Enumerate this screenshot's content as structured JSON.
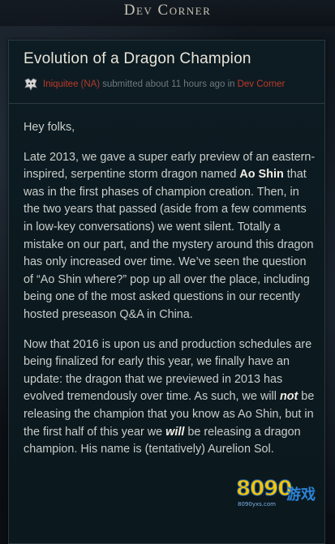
{
  "section": {
    "title": "Dev Corner"
  },
  "post": {
    "title": "Evolution of a Dragon Champion",
    "author": "Iniquitee",
    "region": "(NA)",
    "submitted_text": "submitted about 11 hours ago in",
    "board_link": "Dev Corner"
  },
  "content": {
    "greeting": "Hey folks,",
    "p2_a": "Late 2013, we gave a super early preview of an eastern-inspired, serpentine storm dragon named ",
    "p2_bold": "Ao Shin",
    "p2_b": " that was in the first phases of champion creation. Then, in the two years that passed (aside from a few comments in low-key conversations) we went silent. Totally a mistake on our part, and the mystery around this dragon has only increased over time. We’ve seen the question of “Ao Shin where?” pop up all over the place, including being one of the most asked questions in our recently hosted preseason Q&A in China.",
    "p3_a": "Now that 2016 is upon us and production schedules are being finalized for early this year, we finally have an update: the dragon that we previewed in 2013 has evolved tremendously over time. As such, we will ",
    "p3_bold1": "not",
    "p3_b": " be releasing the champion that you know as Ao Shin, but in the first half of this year we ",
    "p3_bold2": "will",
    "p3_c": " be releasing a dragon champion. His name is (tentatively) Aurelion Sol."
  },
  "watermark": {
    "number": "8090",
    "sub": "游戏",
    "url": "8090yxs.com"
  },
  "icons": {
    "badge": "dragon-badge-icon"
  },
  "colors": {
    "author_red": "#c0392b",
    "title_text": "#e8e4da",
    "body_text": "#c9cdca",
    "panel_bg": "#0d1c22"
  }
}
